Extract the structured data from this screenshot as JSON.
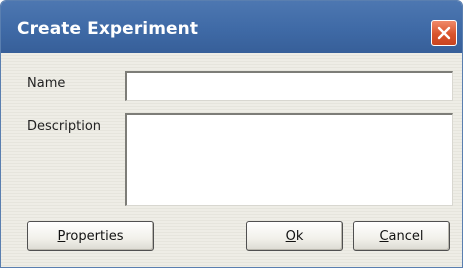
{
  "window": {
    "title": "Create Experiment"
  },
  "form": {
    "name_label": "Name",
    "name_value": "",
    "description_label": "Description",
    "description_value": ""
  },
  "buttons": {
    "properties": {
      "mnemonic": "P",
      "rest": "roperties"
    },
    "ok": {
      "mnemonic": "O",
      "rest": "k"
    },
    "cancel": {
      "mnemonic": "C",
      "rest": "ancel"
    }
  },
  "icons": {
    "close": "close-icon"
  },
  "colors": {
    "titlebar": "#3f6aa6",
    "close_button": "#d9542c",
    "dialog_background": "#ecebe4"
  }
}
